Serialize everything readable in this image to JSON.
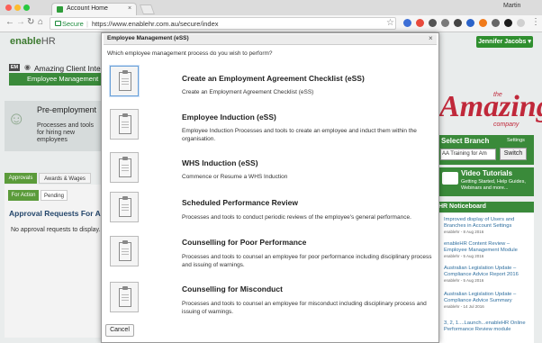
{
  "browser": {
    "tab_title": "Account Home",
    "tab_close": "×",
    "profile_name": "Martin",
    "secure_label": "Secure",
    "url": "https://www.enablehr.com.au/secure/index",
    "url_separator": "|",
    "nav": {
      "back": "←",
      "forward": "→",
      "reload": "↻",
      "home": "⌂",
      "star": "☆",
      "menu": "⋮"
    }
  },
  "app": {
    "logo_main": "enable",
    "logo_suffix": "HR",
    "user_button": "Jennifer Jacobs ▾",
    "em_badge": "EM",
    "company_name": "Amazing Client Interna",
    "employee_management_button": "Employee Management",
    "preemployment": {
      "title": "Pre-employment",
      "description": "Processes and tools for hiring new employees"
    },
    "tabs": [
      "Approvals",
      "Awards & Wages"
    ],
    "subtabs": [
      "For Action",
      "Pending"
    ],
    "approvals_title": "Approval Requests For Ac",
    "approvals_empty": "No approval requests to display."
  },
  "right_panel": {
    "brand_the": "the",
    "brand_name": "Amazing",
    "brand_company": "company",
    "select_branch": {
      "title": "Select Branch",
      "settings": "Settings",
      "value": "AA Training for Am",
      "switch_button": "Switch"
    },
    "video": {
      "title": "Video Tutorials",
      "description": "Getting Started, Help Guides, Webinars and more..."
    },
    "noticeboard": {
      "title": "HR Noticeboard",
      "items": [
        {
          "text": "Improved display of Users and Branches in Account Settings",
          "meta": "enablehr - 8 Aug 2016"
        },
        {
          "text": "enableHR Content Review – Employee Management Module",
          "meta": "enablehr - 5 Aug 2016"
        },
        {
          "text": "Australian Legislation Update – Compliance Advice Report 2016",
          "meta": "enablehr - 5 Aug 2016"
        },
        {
          "text": "Australian Legislation Update – Compliance Advice Summary",
          "meta": "enablehr - 14 Jul 2016"
        },
        {
          "text": "3, 2, 1....Launch...enableHR Online Performance Review module",
          "meta": ""
        }
      ]
    }
  },
  "modal": {
    "title": "Employee Management (eSS)",
    "close": "×",
    "prompt": "Which employee management process do you wish to perform?",
    "options": [
      {
        "title": "Create an Employment Agreement Checklist (eSS)",
        "description": "Create an Employment Agreement Checklist (eSS)",
        "icon": "clipboard-icon"
      },
      {
        "title": "Employee Induction (eSS)",
        "description": "Employee Induction Processes and tools to create an employee and induct them within the organisation.",
        "icon": "clipboard-icon"
      },
      {
        "title": "WHS Induction (eSS)",
        "description": "Commence or Resume a WHS Induction",
        "icon": "clipboard-icon"
      },
      {
        "title": "Scheduled Performance Review",
        "description": "Processes and tools to conduct periodic reviews of the employee's general performance.",
        "icon": "clipboard-icon"
      },
      {
        "title": "Counselling for Poor Performance",
        "description": "Processes and tools to counsel an employee for poor performance including disciplinary process and issuing of warnings.",
        "icon": "clipboard-icon"
      },
      {
        "title": "Counselling for Misconduct",
        "description": "Processes and tools to counsel an employee for misconduct including disciplinary process and issuing of warnings.",
        "icon": "clipboard-icon"
      }
    ],
    "cancel": "Cancel"
  },
  "colors": {
    "brand_green": "#3a8a3a",
    "brand_red": "#c0283a",
    "link_blue": "#2f6f9f"
  }
}
